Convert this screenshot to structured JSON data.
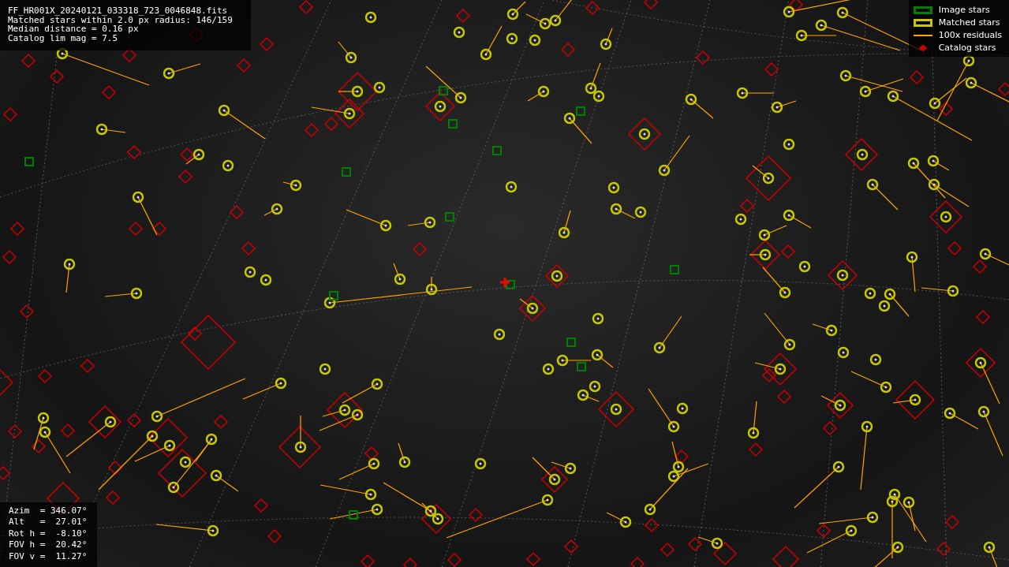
{
  "info_lines": [
    "FF_HR001X_20240121_033318_723_0046848.fits",
    "Matched stars within 2.0 px radius: 146/159",
    "Median distance = 0.16 px",
    "Catalog lim mag = 7.5"
  ],
  "legend": [
    {
      "kind": "box",
      "color": "#008000",
      "label": "Image stars"
    },
    {
      "kind": "box",
      "color": "#c8c800",
      "label": "Matched stars"
    },
    {
      "kind": "line",
      "color": "#ffa500",
      "label": "100x residuals"
    },
    {
      "kind": "diamond",
      "color": "#cc0000",
      "label": "Catalog stars"
    }
  ],
  "pointing_lines": [
    "Azim  = 346.07°",
    "Alt   =  27.01°",
    "Rot h =  -8.10°",
    "FOV h =  20.42°",
    "FOV v =  11.27°"
  ]
}
